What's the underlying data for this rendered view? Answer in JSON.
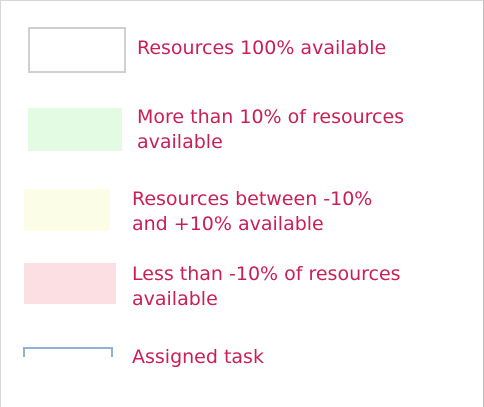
{
  "legend": {
    "items": [
      {
        "label": "Resources 100% available",
        "swatch_color": "#ffffff",
        "swatch_border": "#d0d0d0"
      },
      {
        "label": "More than 10% of resources\navailable",
        "swatch_color": "#e4fbe3"
      },
      {
        "label": "Resources between -10%\nand +10% available",
        "swatch_color": "#fcfde6"
      },
      {
        "label": "Less than -10% of resources\navailable",
        "swatch_color": "#fcdfe3"
      },
      {
        "label": "Assigned task",
        "swatch_color": "#8eb2d8"
      }
    ],
    "text_color": "#c81f55"
  }
}
